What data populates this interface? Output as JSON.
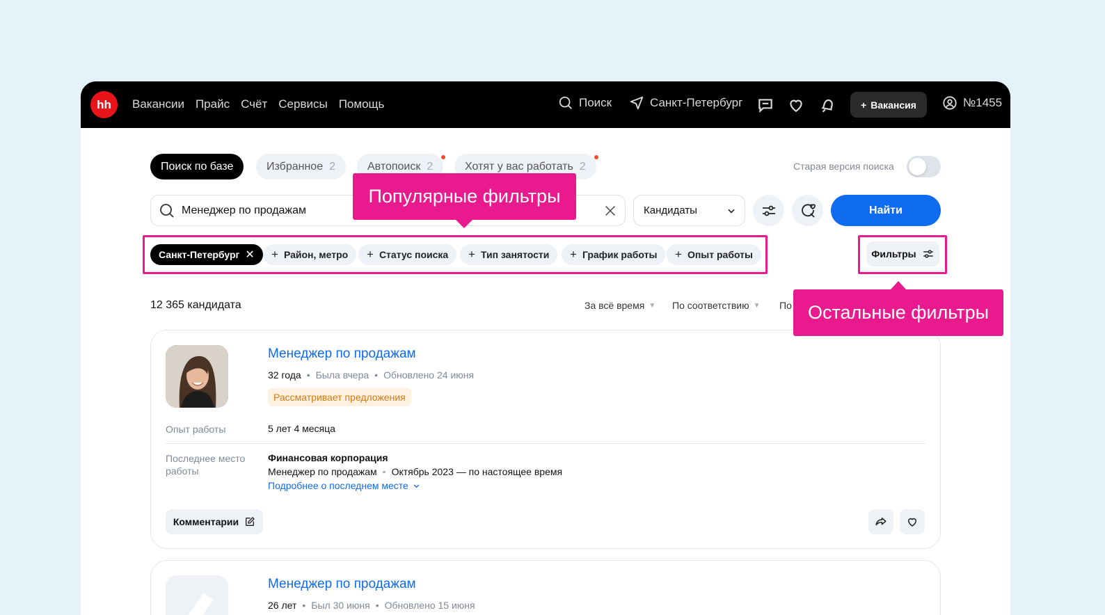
{
  "topbar": {
    "logo": "hh",
    "nav": [
      "Вакансии",
      "Прайс",
      "Счёт",
      "Сервисы",
      "Помощь"
    ],
    "search_label": "Поиск",
    "city": "Санкт-Петербург",
    "vacancy_button": "Вакансия",
    "account": "№1455"
  },
  "tabs": [
    {
      "label": "Поиск по базе",
      "count": ""
    },
    {
      "label": "Избранное",
      "count": "2"
    },
    {
      "label": "Автопоиск",
      "count": "2"
    },
    {
      "label": "Хотят у вас работать",
      "count": "2"
    }
  ],
  "old_version_label": "Старая версия поиска",
  "search": {
    "value": "Менеджер по продажам"
  },
  "select": {
    "value": "Кандидаты"
  },
  "find_button": "Найти",
  "chips": {
    "selected": "Санкт-Петербург",
    "items": [
      "Район, метро",
      "Статус поиска",
      "Тип занятости",
      "График работы",
      "Опыт работы"
    ]
  },
  "filters_button": "Фильтры",
  "callouts": {
    "popular": "Популярные фильтры",
    "other": "Остальные фильтры"
  },
  "results": {
    "count": "12 365 кандидата",
    "sort": [
      "За всё время",
      "По соответствию",
      "По"
    ]
  },
  "card1": {
    "title": "Менеджер по продажам",
    "age": "32 года",
    "seen": "Была вчера",
    "updated": "Обновлено 24 июня",
    "status": "Рассматривает предложения",
    "experience_label": "Опыт работы",
    "experience_value": "5 лет 4 месяца",
    "last_place_label": "Последнее место работы",
    "company": "Финансовая корпорация",
    "position": "Менеджер по продажам",
    "period": "Октябрь 2023 — по настоящее время",
    "more_link": "Подробнее о последнем месте",
    "comment_button": "Комментарии"
  },
  "card2": {
    "title": "Менеджер по продажам",
    "age": "26 лет",
    "seen": "Был 30 июня",
    "updated": "Обновлено 15 июня"
  },
  "colors": {
    "accent": "#0f6bf0",
    "callout": "#e81a8e",
    "logo": "#e8141a",
    "badge_text": "#d27a10"
  }
}
